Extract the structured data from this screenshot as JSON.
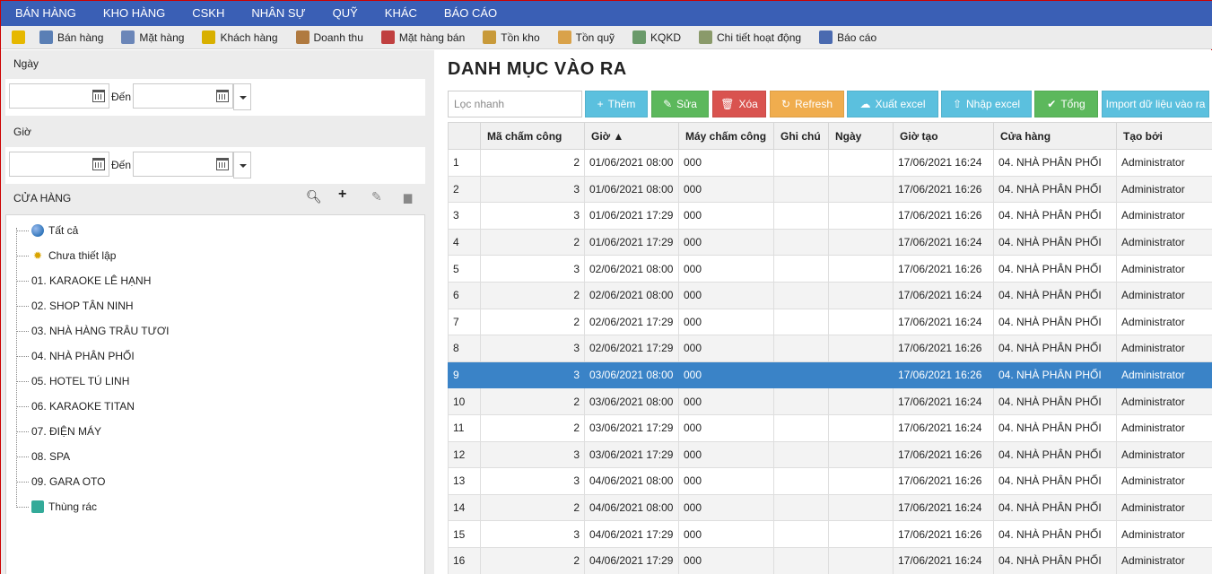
{
  "topnav": [
    "BÁN HÀNG",
    "KHO HÀNG",
    "CSKH",
    "NHÂN SỰ",
    "QUỸ",
    "KHÁC",
    "BÁO CÁO"
  ],
  "toolbar": [
    {
      "label": "",
      "icon": "lightning-icon",
      "color": "#e6b800"
    },
    {
      "label": "Bán hàng",
      "icon": "sales-icon",
      "color": "#5a7fb5"
    },
    {
      "label": "Mặt hàng",
      "icon": "product-icon",
      "color": "#6b86b8"
    },
    {
      "label": "Khách hàng",
      "icon": "customer-icon",
      "color": "#d8b000"
    },
    {
      "label": "Doanh thu",
      "icon": "revenue-icon",
      "color": "#b07a40"
    },
    {
      "label": "Mặt hàng bán",
      "icon": "chart-bar-icon",
      "color": "#c04040"
    },
    {
      "label": "Tồn kho",
      "icon": "stock-icon",
      "color": "#c89a3a"
    },
    {
      "label": "Tồn quỹ",
      "icon": "coins-icon",
      "color": "#d9a24a"
    },
    {
      "label": "KQKD",
      "icon": "trend-icon",
      "color": "#6a9a6a"
    },
    {
      "label": "Chi tiết hoạt động",
      "icon": "activity-icon",
      "color": "#8a9a6a"
    },
    {
      "label": "Báo cáo",
      "icon": "report-icon",
      "color": "#4a6ab0"
    }
  ],
  "filters": {
    "date_label": "Ngày",
    "time_label": "Giờ",
    "to_label": "Đến"
  },
  "stores": {
    "heading": "CỬA HÀNG",
    "items": [
      {
        "label": "Tất cả",
        "icon": "globe-icon"
      },
      {
        "label": "Chưa thiết lập",
        "icon": "gear-icon"
      },
      {
        "label": "01. KARAOKE LÊ HẠNH",
        "icon": ""
      },
      {
        "label": "02. SHOP TÂN NINH",
        "icon": ""
      },
      {
        "label": "03. NHÀ HÀNG TRÂU TƯƠI",
        "icon": ""
      },
      {
        "label": "04. NHÀ PHÂN PHỐI",
        "icon": ""
      },
      {
        "label": "05. HOTEL TÚ LINH",
        "icon": ""
      },
      {
        "label": "06. KARAOKE TITAN",
        "icon": ""
      },
      {
        "label": "07. ĐIỆN MÁY",
        "icon": ""
      },
      {
        "label": "08. SPA",
        "icon": ""
      },
      {
        "label": "09. GARA OTO",
        "icon": ""
      },
      {
        "label": "Thùng rác",
        "icon": "trash-icon"
      }
    ]
  },
  "main": {
    "title": "DANH MỤC VÀO RA",
    "search_placeholder": "Lọc nhanh",
    "buttons": [
      {
        "label": "Thêm",
        "glyph": "+",
        "color": "#5bc0de"
      },
      {
        "label": "Sửa",
        "glyph": "✎",
        "color": "#5cb85c"
      },
      {
        "label": "Xóa",
        "glyph": "🗑",
        "color": "#d9534f"
      },
      {
        "label": "Refresh",
        "glyph": "↻",
        "color": "#f0ad4e"
      },
      {
        "label": "Xuất excel",
        "glyph": "☁",
        "color": "#5bc0de"
      },
      {
        "label": "Nhập excel",
        "glyph": "⇧",
        "color": "#5bc0de"
      },
      {
        "label": "Tổng",
        "glyph": "✔",
        "color": "#5cb85c"
      },
      {
        "label": "Import dữ liệu vào ra",
        "glyph": "",
        "color": "#5bc0de"
      }
    ],
    "columns": [
      "",
      "Mã chấm công",
      "Giờ ▲",
      "Máy chấm công",
      "Ghi chú",
      "Ngày",
      "Giờ tạo",
      "Cửa hàng",
      "Tạo bởi"
    ],
    "selected_row": 9,
    "rows": [
      [
        "1",
        "2",
        "01/06/2021 08:00",
        "000",
        "",
        "",
        "17/06/2021 16:24",
        "04. NHÀ PHÂN PHỐI",
        "Administrator"
      ],
      [
        "2",
        "3",
        "01/06/2021 08:00",
        "000",
        "",
        "",
        "17/06/2021 16:26",
        "04. NHÀ PHÂN PHỐI",
        "Administrator"
      ],
      [
        "3",
        "3",
        "01/06/2021 17:29",
        "000",
        "",
        "",
        "17/06/2021 16:26",
        "04. NHÀ PHÂN PHỐI",
        "Administrator"
      ],
      [
        "4",
        "2",
        "01/06/2021 17:29",
        "000",
        "",
        "",
        "17/06/2021 16:24",
        "04. NHÀ PHÂN PHỐI",
        "Administrator"
      ],
      [
        "5",
        "3",
        "02/06/2021 08:00",
        "000",
        "",
        "",
        "17/06/2021 16:26",
        "04. NHÀ PHÂN PHỐI",
        "Administrator"
      ],
      [
        "6",
        "2",
        "02/06/2021 08:00",
        "000",
        "",
        "",
        "17/06/2021 16:24",
        "04. NHÀ PHÂN PHỐI",
        "Administrator"
      ],
      [
        "7",
        "2",
        "02/06/2021 17:29",
        "000",
        "",
        "",
        "17/06/2021 16:24",
        "04. NHÀ PHÂN PHỐI",
        "Administrator"
      ],
      [
        "8",
        "3",
        "02/06/2021 17:29",
        "000",
        "",
        "",
        "17/06/2021 16:26",
        "04. NHÀ PHÂN PHỐI",
        "Administrator"
      ],
      [
        "9",
        "3",
        "03/06/2021 08:00",
        "000",
        "",
        "",
        "17/06/2021 16:26",
        "04. NHÀ PHÂN PHỐI",
        "Administrator"
      ],
      [
        "10",
        "2",
        "03/06/2021 08:00",
        "000",
        "",
        "",
        "17/06/2021 16:24",
        "04. NHÀ PHÂN PHỐI",
        "Administrator"
      ],
      [
        "11",
        "2",
        "03/06/2021 17:29",
        "000",
        "",
        "",
        "17/06/2021 16:24",
        "04. NHÀ PHÂN PHỐI",
        "Administrator"
      ],
      [
        "12",
        "3",
        "03/06/2021 17:29",
        "000",
        "",
        "",
        "17/06/2021 16:26",
        "04. NHÀ PHÂN PHỐI",
        "Administrator"
      ],
      [
        "13",
        "3",
        "04/06/2021 08:00",
        "000",
        "",
        "",
        "17/06/2021 16:26",
        "04. NHÀ PHÂN PHỐI",
        "Administrator"
      ],
      [
        "14",
        "2",
        "04/06/2021 08:00",
        "000",
        "",
        "",
        "17/06/2021 16:24",
        "04. NHÀ PHÂN PHỐI",
        "Administrator"
      ],
      [
        "15",
        "3",
        "04/06/2021 17:29",
        "000",
        "",
        "",
        "17/06/2021 16:26",
        "04. NHÀ PHÂN PHỐI",
        "Administrator"
      ],
      [
        "16",
        "2",
        "04/06/2021 17:29",
        "000",
        "",
        "",
        "17/06/2021 16:24",
        "04. NHÀ PHÂN PHỐI",
        "Administrator"
      ]
    ]
  }
}
